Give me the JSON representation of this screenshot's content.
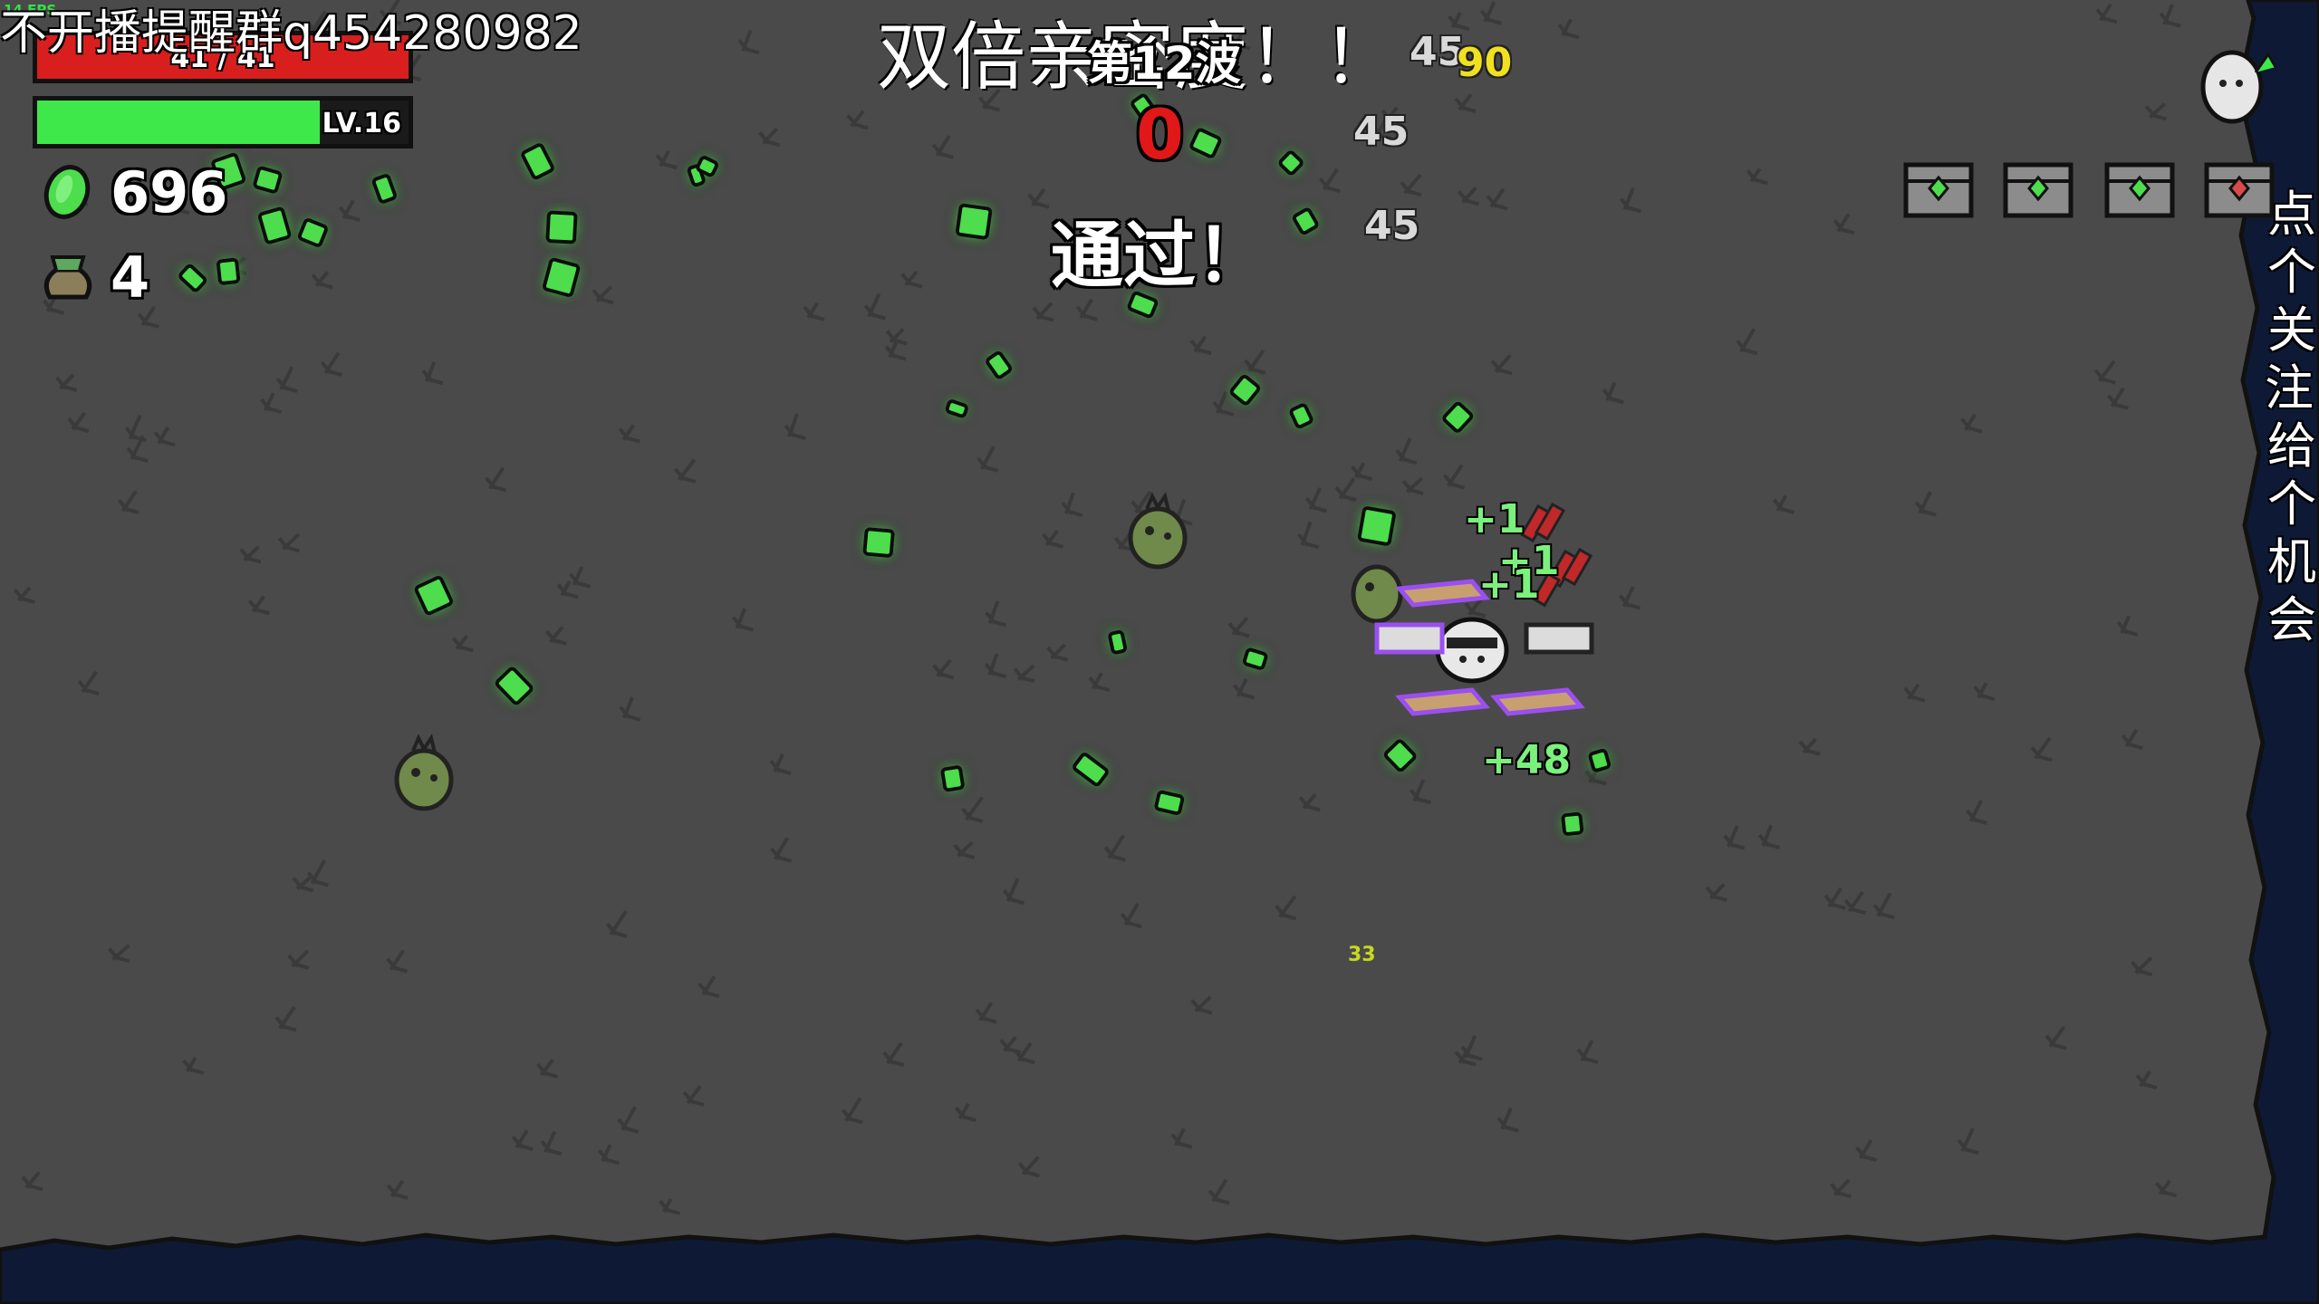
{
  "hud": {
    "fps": "14 FPS",
    "health_text": "41 / 41",
    "health_fraction": 1.0,
    "level_label": "LV.16",
    "xp_fraction": 0.76,
    "materials_count": "696",
    "bag_count": "4"
  },
  "overlay": {
    "streamer_note": "不开播提醒群q454280982",
    "double_intimacy": "双倍亲密度！！",
    "wave_label": "第12波",
    "timer": "0",
    "cleared": "通过！",
    "vertical_note": "点个关注，给个机会",
    "small_number": "33"
  },
  "damage_numbers": [
    "45",
    "90",
    "45",
    "45"
  ],
  "pickups": [
    "+1",
    "+1",
    "+1",
    "+48"
  ],
  "colors": {
    "health_red": "#d91e1e",
    "xp_green": "#3ee84a",
    "material_green": "#4ddd4d",
    "timer_red": "#e01818",
    "crit_yellow": "#f0e020",
    "ground": "#4a4a4a",
    "water": "#0e1a35",
    "weapon_outline_purple": "#9b4ff0"
  },
  "icons": {
    "materials": "green-material-icon",
    "bag": "money-bag-icon",
    "chests": "crate-icon",
    "level_up": "egg-upgrade-icon"
  }
}
